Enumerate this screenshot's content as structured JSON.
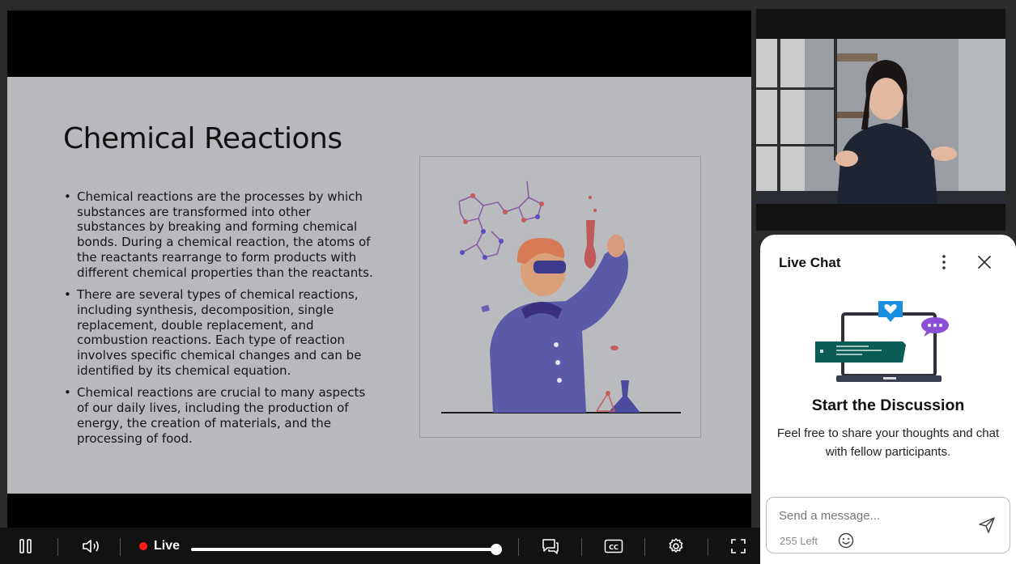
{
  "slide": {
    "title": "Chemical Reactions",
    "bullets": [
      "Chemical reactions are the processes by which substances are transformed into other substances by breaking and forming chemical bonds. During a chemical reaction, the atoms of the reactants rearrange to form products with different chemical properties than the reactants.",
      "There are several types of chemical reactions, including synthesis, decomposition, single replacement, double replacement, and combustion reactions. Each type of reaction involves specific chemical changes and can be identified by its chemical equation.",
      "Chemical reactions are crucial to many aspects of our daily lives, including the production of energy, the creation of materials, and the processing of food."
    ]
  },
  "controls": {
    "live_label": "Live",
    "progress": 1.0
  },
  "chat": {
    "title": "Live Chat",
    "heading": "Start the Discussion",
    "subtext": "Feel free to share your thoughts and chat with fellow participants.",
    "placeholder": "Send a message...",
    "chars_left": "255 Left"
  },
  "colors": {
    "live_dot": "#ff1a1a",
    "teal": "#0b5c56",
    "heart": "#1a8fe0",
    "bubble": "#8b4fd6"
  },
  "icons": [
    "pause-icon",
    "volume-icon",
    "chat-toggle-icon",
    "captions-icon",
    "settings-icon",
    "fullscreen-icon",
    "more-vertical-icon",
    "close-icon",
    "emoji-icon",
    "send-icon"
  ]
}
